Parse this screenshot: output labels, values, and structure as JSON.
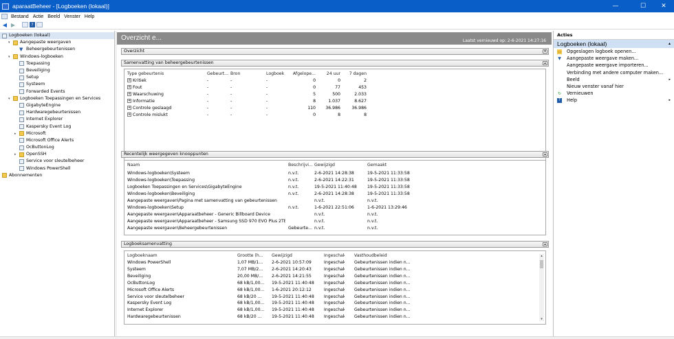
{
  "window": {
    "title": "aparaatBeheer - [Logboeken (lokaal)]",
    "min": "—",
    "max": "☐",
    "close": "✕"
  },
  "menu": [
    "Bestand",
    "Actie",
    "Beeld",
    "Venster",
    "Help"
  ],
  "tree": [
    {
      "label": "Logboeken (lokaal)",
      "level": 0,
      "icon": "log",
      "selected": true
    },
    {
      "label": "Aangepaste weergaven",
      "level": 1,
      "icon": "folder",
      "expand": "v"
    },
    {
      "label": "Beheergebeurtenissen",
      "level": 2,
      "icon": "filter"
    },
    {
      "label": "Windows-logboeken",
      "level": 1,
      "icon": "folder",
      "expand": "v"
    },
    {
      "label": "Toepassing",
      "level": 2,
      "icon": "log"
    },
    {
      "label": "Beveiliging",
      "level": 2,
      "icon": "log"
    },
    {
      "label": "Setup",
      "level": 2,
      "icon": "log"
    },
    {
      "label": "Systeem",
      "level": 2,
      "icon": "log"
    },
    {
      "label": "Forwarded Events",
      "level": 2,
      "icon": "log"
    },
    {
      "label": "Logboeken Toepassingen en Services",
      "level": 1,
      "icon": "folder",
      "expand": "v"
    },
    {
      "label": "GigabyteEngine",
      "level": 2,
      "icon": "log"
    },
    {
      "label": "Hardwaregebeurtenissen",
      "level": 2,
      "icon": "log"
    },
    {
      "label": "Internet Explorer",
      "level": 2,
      "icon": "log"
    },
    {
      "label": "Kaspersky Event Log",
      "level": 2,
      "icon": "log"
    },
    {
      "label": "Microsoft",
      "level": 2,
      "icon": "folder",
      "expand": ">"
    },
    {
      "label": "Microsoft Office Alerts",
      "level": 2,
      "icon": "log"
    },
    {
      "label": "OcButtonLog",
      "level": 2,
      "icon": "log"
    },
    {
      "label": "OpenSSH",
      "level": 2,
      "icon": "folder",
      "expand": ">"
    },
    {
      "label": "Service voor sleutelbeheer",
      "level": 2,
      "icon": "log"
    },
    {
      "label": "Windows PowerShell",
      "level": 2,
      "icon": "log"
    },
    {
      "label": "Abonnementen",
      "level": 0,
      "icon": "subs"
    }
  ],
  "center": {
    "title": "Overzicht e...",
    "updated": "Laatst vernieuwd op: 2-6-2021 14:27:16",
    "overview_label": "Overzicht",
    "summary": {
      "title": "Samenvatting van beheergebeurtenissen",
      "columns": [
        "Type gebeurtenis",
        "Gebeurt...",
        "Bron",
        "Logboek",
        "Afgelope...",
        "24 uur",
        "7 dagen"
      ],
      "rows": [
        [
          "Kritiek",
          "-",
          "-",
          "-",
          "0",
          "0",
          "2"
        ],
        [
          "Fout",
          "-",
          "-",
          "-",
          "0",
          "77",
          "453"
        ],
        [
          "Waarschuwing",
          "-",
          "-",
          "-",
          "5",
          "500",
          "2.033"
        ],
        [
          "Informatie",
          "-",
          "-",
          "-",
          "8",
          "1.037",
          "8.627"
        ],
        [
          "Controle geslaagd",
          "-",
          "-",
          "-",
          "110",
          "36.986",
          "36.986"
        ],
        [
          "Controle mislukt",
          "-",
          "-",
          "-",
          "0",
          "8",
          "8"
        ]
      ]
    },
    "recent": {
      "title": "Recentelijk weergegeven knooppunten",
      "columns": [
        "Naam",
        "Beschrijvi...",
        "Gewijzigd",
        "Gemaakt"
      ],
      "rows": [
        [
          "Windows-logboeken\\Systeem",
          "n.v.t.",
          "2-6-2021 14:28:38",
          "19-5-2021 11:33:58"
        ],
        [
          "Windows-logboeken\\Toepassing",
          "n.v.t.",
          "2-6-2021 14:22:31",
          "19-5-2021 11:33:58"
        ],
        [
          "Logboeken Toepassingen en Services\\GigabyteEngine",
          "n.v.t.",
          "19-5-2021 11:40:48",
          "19-5-2021 11:33:58"
        ],
        [
          "Windows-logboeken\\Beveiliging",
          "n.v.t.",
          "2-6-2021 14:28:38",
          "19-5-2021 11:33:58"
        ],
        [
          "Aangepaste weergaven\\Pagina met samenvatting van gebeurtenissen",
          "",
          "n.v.t.",
          "n.v.t."
        ],
        [
          "Windows-logboeken\\Setup",
          "n.v.t.",
          "1-6-2021 22:51:06",
          "1-6-2021 13:29:46"
        ],
        [
          "Aangepaste weergaven\\Apparaatbeheer - Generic Billboard Device",
          "",
          "n.v.t.",
          "n.v.t."
        ],
        [
          "Aangepaste weergaven\\Apparaatbeheer - Samsung SSD 970 EVO Plus 2TB",
          "",
          "n.v.t.",
          "n.v.t."
        ],
        [
          "Aangepaste weergaven\\Beheergebeurtenissen",
          "Gebeurte...",
          "n.v.t.",
          "n.v.t."
        ]
      ]
    },
    "logsummary": {
      "title": "Logboeksamenvatting",
      "columns": [
        "Logboeknaam",
        "Grootte (h...",
        "Gewijzigd",
        "Ingeschak...",
        "Vasthoudbeleid"
      ],
      "rows": [
        [
          "Windows PowerShell",
          "1,07 MB/1...",
          "2-6-2021 10:57:09",
          "Ingeschak...",
          "Gebeurtenissen indien n..."
        ],
        [
          "Systeem",
          "7,07 MB/2...",
          "2-6-2021 14:20:43",
          "Ingeschak...",
          "Gebeurtenissen indien n..."
        ],
        [
          "Beveiliging",
          "20,00 MB/...",
          "2-6-2021 14:21:55",
          "Ingeschak...",
          "Gebeurtenissen indien n..."
        ],
        [
          "OcButtonLog",
          "68 kB/1,00...",
          "19-5-2021 11:40:48",
          "Ingeschak...",
          "Gebeurtenissen indien n..."
        ],
        [
          "Microsoft Office Alerts",
          "68 kB/1,00...",
          "1-6-2021 20:12:12",
          "Ingeschak...",
          "Gebeurtenissen indien n..."
        ],
        [
          "Service voor sleutelbeheer",
          "68 kB/20 ...",
          "19-5-2021 11:40:48",
          "Ingeschak...",
          "Gebeurtenissen indien n..."
        ],
        [
          "Kaspersky Event Log",
          "68 kB/1,00...",
          "19-5-2021 11:40:48",
          "Ingeschak...",
          "Gebeurtenissen indien n..."
        ],
        [
          "Internet Explorer",
          "68 kB/1,00...",
          "19-5-2021 11:40:48",
          "Ingeschak...",
          "Gebeurtenissen indien n..."
        ],
        [
          "Hardwaregebeurtenissen",
          "68 kB/20 ...",
          "19-5-2021 11:40:48",
          "Ingeschak...",
          "Gebeurtenissen indien n..."
        ]
      ]
    }
  },
  "actions": {
    "title": "Acties",
    "section": "Logboeken (lokaal)",
    "items": [
      {
        "label": "Opgeslagen logboek openen...",
        "icon": "folder-open-icon"
      },
      {
        "label": "Aangepaste weergave maken...",
        "icon": "filter-icon"
      },
      {
        "label": "Aangepaste weergave importeren...",
        "icon": ""
      },
      {
        "label": "Verbinding met andere computer maken...",
        "icon": ""
      },
      {
        "label": "Beeld",
        "icon": "",
        "sub": "▸"
      },
      {
        "label": "Nieuw venster vanaf hier",
        "icon": ""
      },
      {
        "label": "Vernieuwen",
        "icon": "refresh-icon"
      },
      {
        "label": "Help",
        "icon": "help-icon",
        "sub": "▸"
      }
    ]
  }
}
